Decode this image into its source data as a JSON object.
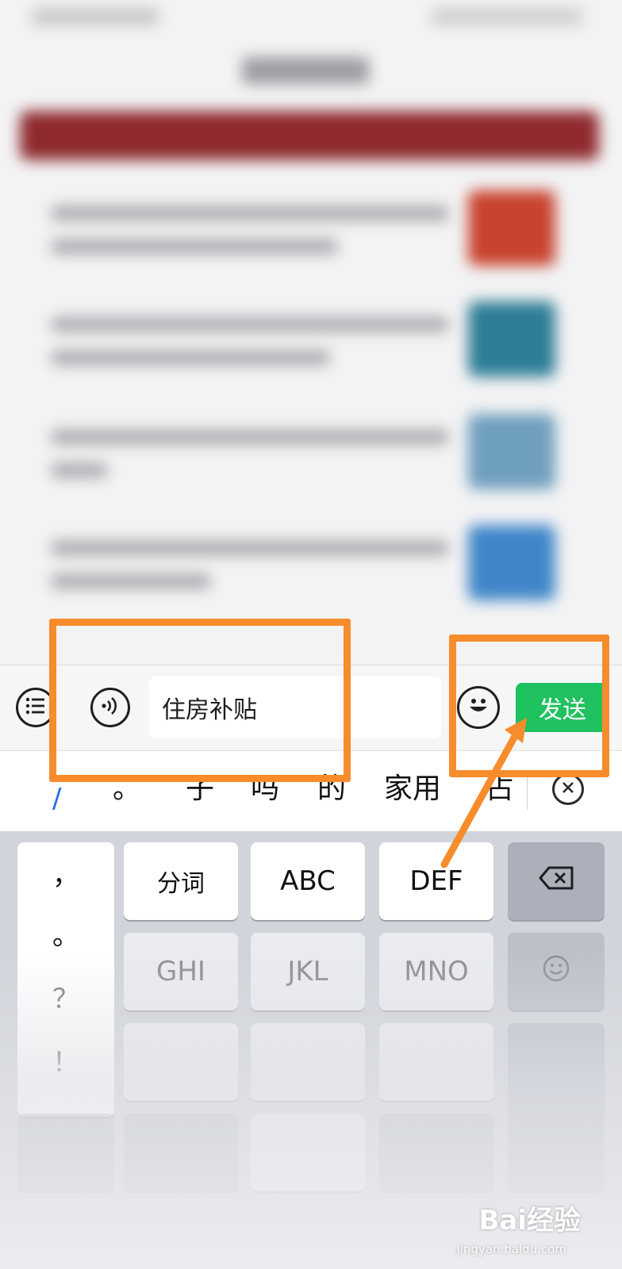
{
  "chat_input": {
    "text_value": "住房补贴",
    "send_label": "发送"
  },
  "candidates": {
    "items": [
      "。",
      "子",
      "吗",
      "的",
      "家用",
      "占"
    ]
  },
  "keyboard": {
    "punctuation": [
      "，",
      "。",
      "？",
      "！"
    ],
    "keys": {
      "segment": "分词",
      "abc": "ABC",
      "def": "DEF",
      "ghi": "GHI",
      "jkl": "JKL",
      "mno": "MNO"
    }
  },
  "colors": {
    "send_button": "#1fc25f",
    "annotation": "#f78c2c",
    "caret": "#1e6ee6"
  },
  "icons": {
    "menu": "list-menu-icon",
    "voice": "voice-icon",
    "emoji": "emoji-icon",
    "clear": "close-circle-icon",
    "backspace": "backspace-icon",
    "emoji_key": "smiley-icon"
  },
  "watermark": {
    "brand": "Bai经验",
    "url": "jingyan.baidu.com"
  }
}
